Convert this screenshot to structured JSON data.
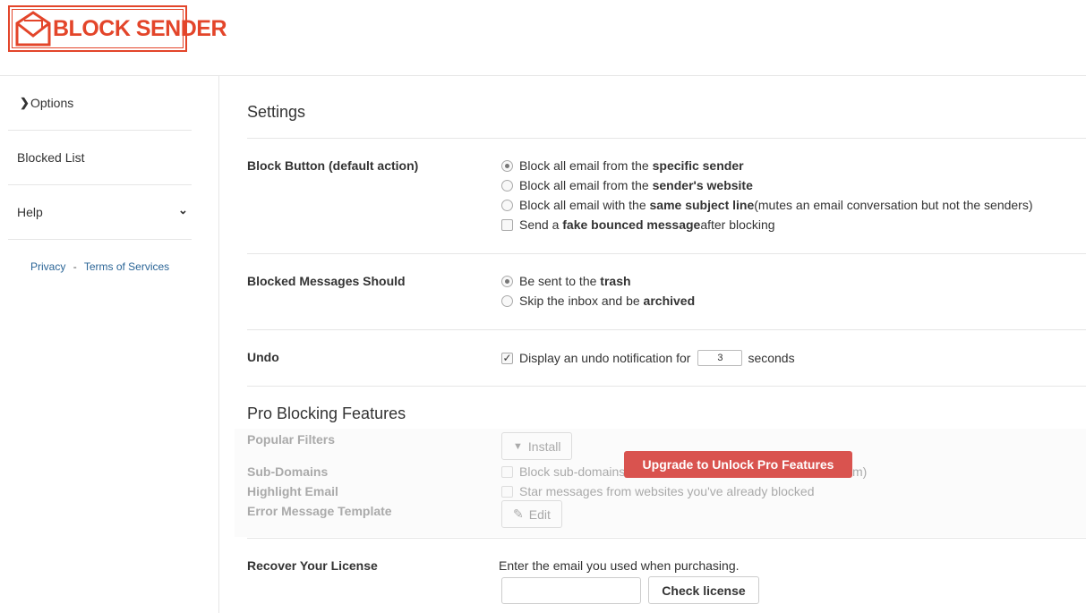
{
  "logo": {
    "text": "BLOCK SENDER",
    "color": "#e3452a"
  },
  "sidebar": {
    "items": [
      {
        "label": "Options",
        "icon": "chevron-right-icon",
        "active": true
      },
      {
        "label": "Blocked List"
      },
      {
        "label": "Help",
        "icon": "chevron-down-icon"
      }
    ],
    "footer": {
      "privacy": "Privacy",
      "separator": "-",
      "terms": "Terms of Services"
    }
  },
  "settings": {
    "title": "Settings",
    "block_button": {
      "label": "Block Button (default action)",
      "options": [
        {
          "pre": "Block all email from the ",
          "bold": "specific sender",
          "post": "",
          "selected": true
        },
        {
          "pre": "Block all email from the ",
          "bold": "sender's website",
          "post": "",
          "selected": false
        },
        {
          "pre": "Block all email with the ",
          "bold": "same subject line",
          "post": " (mutes an email conversation but not the senders)",
          "selected": false
        }
      ],
      "fake_bounce": {
        "pre": "Send a ",
        "bold": "fake bounced message",
        "post": " after blocking",
        "checked": false
      }
    },
    "blocked_messages": {
      "label": "Blocked Messages Should",
      "options": [
        {
          "pre": "Be sent to the ",
          "bold": "trash",
          "selected": true
        },
        {
          "pre": "Skip the inbox and be ",
          "bold": "archived",
          "selected": false
        }
      ]
    },
    "undo": {
      "label": "Undo",
      "pre": "Display an undo notification for",
      "value": "3",
      "post": "seconds",
      "checked": true
    }
  },
  "pro": {
    "title": "Pro Blocking Features",
    "popular_filters": {
      "label": "Popular Filters",
      "button": "Install",
      "icon": "filter-icon"
    },
    "sub_domains": {
      "label": "Sub-Domains",
      "text_left": "Block sub-domains",
      "text_right": "m)"
    },
    "highlight_email": {
      "label": "Highlight Email",
      "text": "Star messages from websites you've already blocked"
    },
    "error_template": {
      "label": "Error Message Template",
      "button": "Edit",
      "icon": "pencil-icon"
    },
    "upgrade_button": "Upgrade to Unlock Pro Features",
    "upgrade_color": "#d9534f"
  },
  "license": {
    "label": "Recover Your License",
    "hint": "Enter the email you used when purchasing.",
    "email_value": "",
    "button": "Check license"
  }
}
